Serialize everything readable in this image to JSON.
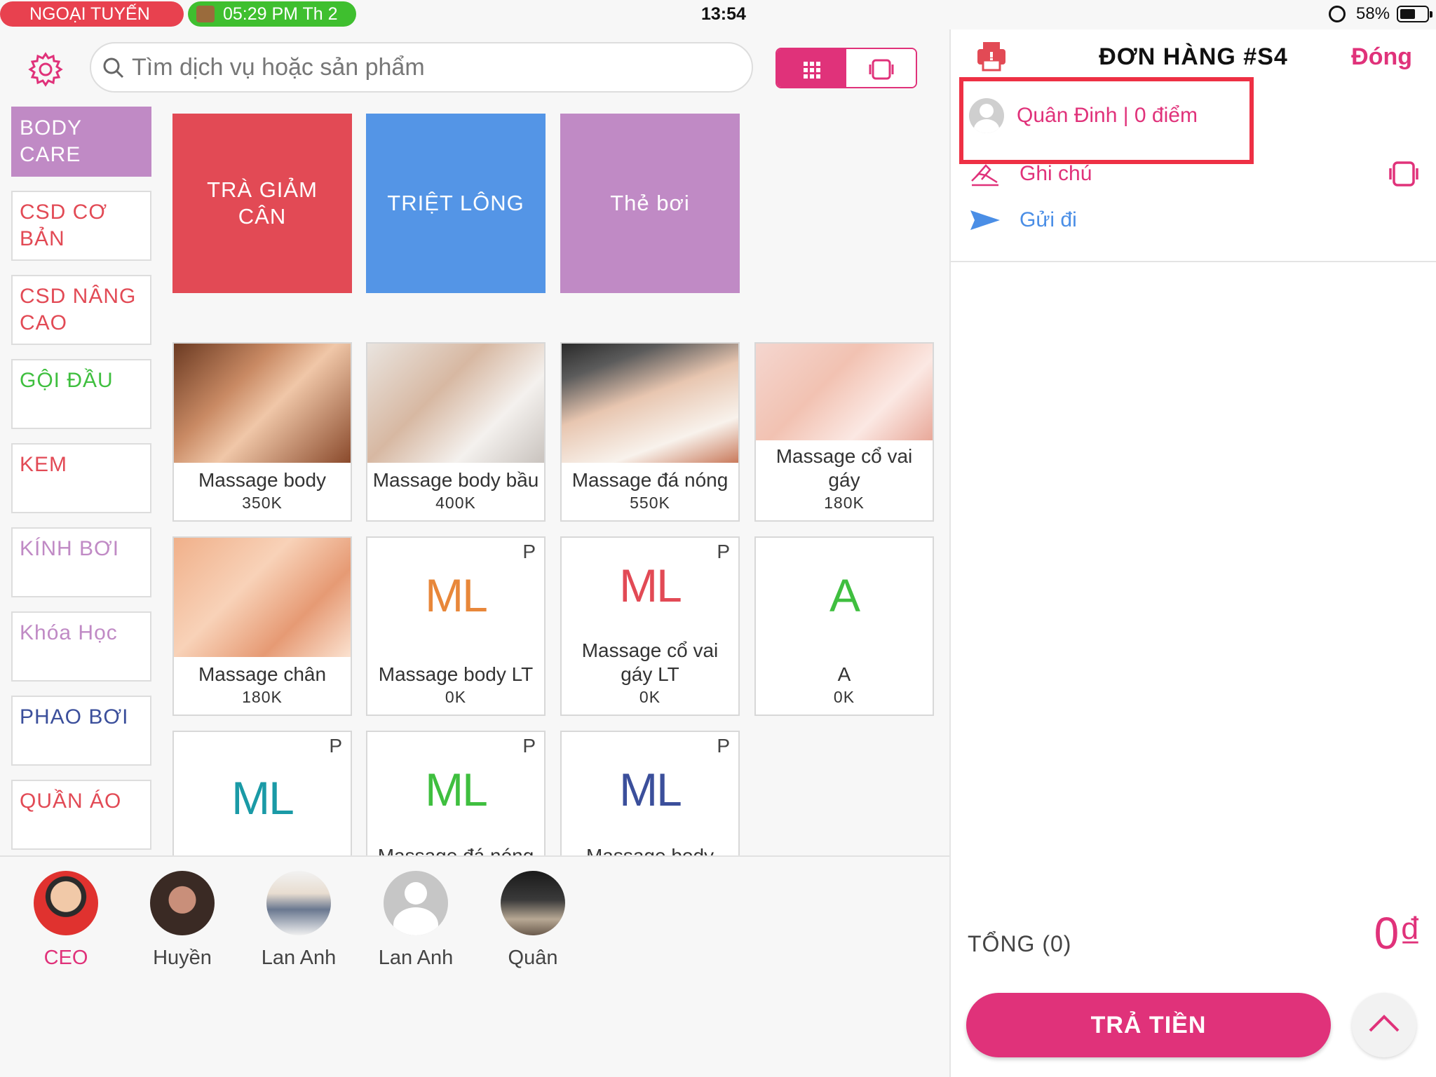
{
  "status_bar": {
    "offline_pill": "NGOẠI TUYẾN",
    "clock_pill": "05:29 PM Th 2",
    "time": "13:54",
    "battery_percent": "58%",
    "battery_level": 0.58
  },
  "search": {
    "placeholder": "Tìm dịch vụ hoặc sản phẩm"
  },
  "colors": {
    "accent": "#e0327a",
    "offline": "#e8414f",
    "online": "#3fbf2f"
  },
  "categories": [
    {
      "label": "BODY CARE",
      "color": "#ffffff",
      "active": true
    },
    {
      "label": "CSD CƠ BẢN",
      "color": "#e24a55"
    },
    {
      "label": "CSD NÂNG CAO",
      "color": "#e24a55"
    },
    {
      "label": "GỘI ĐẦU",
      "color": "#3fbf3f"
    },
    {
      "label": "KEM",
      "color": "#e24a55"
    },
    {
      "label": "KÍNH BƠI",
      "color": "#c08ac5"
    },
    {
      "label": "Khóa Học",
      "color": "#c08ac5"
    },
    {
      "label": "PHAO BƠI",
      "color": "#3b4f9b"
    },
    {
      "label": "QUẦN ÁO",
      "color": "#e24a55"
    }
  ],
  "groups": [
    {
      "label": "TRÀ GIẢM CÂN",
      "color": "#e24a55"
    },
    {
      "label": "TRIỆT LÔNG",
      "color": "#5495e6"
    },
    {
      "label": "Thẻ bơi",
      "color": "#c08ac5"
    }
  ],
  "products": [
    {
      "name": "Massage body",
      "price": "350K",
      "image": "massage-photo"
    },
    {
      "name": "Massage body bầu",
      "price": "400K",
      "image": "pregnancy-massage-photo"
    },
    {
      "name": "Massage đá nóng",
      "price": "550K",
      "image": "hot-stone-photo"
    },
    {
      "name": "Massage cổ vai gáy",
      "price": "180K",
      "image": "neck-massage-photo"
    },
    {
      "name": "Massage chân",
      "price": "180K",
      "image": "foot-massage-photo"
    },
    {
      "name": "Massage body LT",
      "price": "0K",
      "initials": "ML",
      "initials_color": "#e8873a",
      "mark": "P"
    },
    {
      "name": "Massage cổ vai gáy LT",
      "price": "0K",
      "initials": "ML",
      "initials_color": "#e24a55",
      "mark": "P"
    },
    {
      "name": "A",
      "price": "0K",
      "initials": "A",
      "initials_color": "#3fbf3f"
    },
    {
      "name": "",
      "price": "",
      "initials": "ML",
      "initials_color": "#1a9aa6",
      "mark": "P"
    },
    {
      "name": "Massage đá nóng",
      "price": "",
      "initials": "ML",
      "initials_color": "#3fbf3f",
      "mark": "P"
    },
    {
      "name": "Massage body",
      "price": "",
      "initials": "ML",
      "initials_color": "#3b4f9b",
      "mark": "P"
    }
  ],
  "staff": [
    {
      "name": "CEO",
      "active": true,
      "avatar": "man-photo"
    },
    {
      "name": "Huyền",
      "avatar": "woman-photo"
    },
    {
      "name": "Lan Anh",
      "avatar": "woman-standing-photo"
    },
    {
      "name": "Lan Anh",
      "avatar": "default-avatar"
    },
    {
      "name": "Quân",
      "avatar": "office-photo"
    }
  ],
  "order": {
    "title": "ĐƠN HÀNG #S4",
    "close_label": "Đóng",
    "customer": "Quân Đinh | 0  điểm",
    "note_label": "Ghi chú",
    "send_label": "Gửi đi",
    "total_label": "TỔNG (0)",
    "total_value": "0₫",
    "pay_label": "TRẢ TIỀN"
  }
}
